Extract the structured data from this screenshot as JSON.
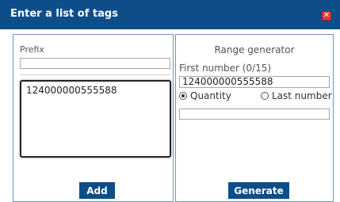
{
  "dialog": {
    "title": "Enter a list of tags",
    "close_icon": "close-icon"
  },
  "left": {
    "prefix_label": "Prefix",
    "prefix_value": "",
    "tags_value": "124000000555588",
    "add_button": "Add"
  },
  "right": {
    "header": "Range generator",
    "first_number_label": "First number (0/15)",
    "first_number_value": "124000000555588",
    "mode_quantity": "Quantity",
    "mode_last_number": "Last number",
    "selected_mode": "Quantity",
    "mode_value": "",
    "generate_button": "Generate"
  },
  "colors": {
    "titlebar": "#0d4d8a",
    "close_button": "#e53935",
    "button": "#0d4d8a",
    "panel_border": "#7a94bd"
  }
}
